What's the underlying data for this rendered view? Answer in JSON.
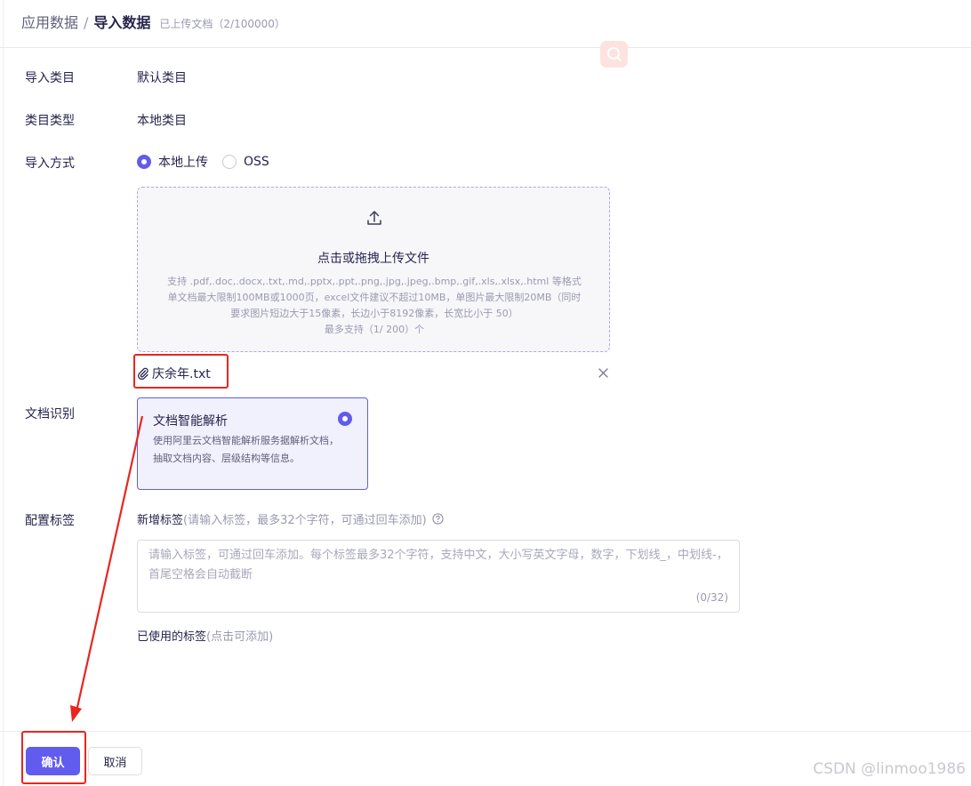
{
  "breadcrumb": {
    "parent": "应用数据",
    "separator": "/",
    "current": "导入数据",
    "meta": "已上传文档（2/100000）"
  },
  "form": {
    "category": {
      "label": "导入类目",
      "value": "默认类目"
    },
    "category_type": {
      "label": "类目类型",
      "value": "本地类目"
    },
    "import_method": {
      "label": "导入方式",
      "options": [
        {
          "label": "本地上传",
          "selected": true
        },
        {
          "label": "OSS",
          "selected": false
        }
      ]
    },
    "upload": {
      "icon": "upload-icon",
      "title": "点击或拖拽上传文件",
      "hint_lines": [
        "支持 .pdf,.doc,.docx,.txt,.md,.pptx,.ppt,.png,.jpg,.jpeg,.bmp,.gif,.xls,.xlsx,.html 等格式",
        "单文档最大限制100MB或1000页，excel文件建议不超过10MB，单图片最大限制20MB（同时",
        "要求图片短边大于15像素，长边小于8192像素，长宽比小于 50）",
        "最多支持（1/ 200）个"
      ]
    },
    "uploaded_file": {
      "name": "庆余年.txt",
      "icon": "paperclip-icon"
    },
    "doc_recognition": {
      "label": "文档识别",
      "option_title": "文档智能解析",
      "option_desc": "使用阿里云文档智能解析服务据解析文档，抽取文档内容、层级结构等信息。",
      "selected": true
    },
    "tags": {
      "label": "配置标签",
      "heading": "新增标签",
      "heading_hint": "(请输入标签，最多32个字符，可通过回车添加)",
      "placeholder": "请输入标签，可通过回车添加。每个标签最多32个字符，支持中文，大小写英文字母，数字，下划线_，中划线-，首尾空格会自动截断",
      "value": "",
      "counter": "(0/32)",
      "used_heading": "已使用的标签",
      "used_hint": "(点击可添加)"
    }
  },
  "footer": {
    "confirm_label": "确认",
    "cancel_label": "取消"
  },
  "watermark": "CSDN @linmoo1986",
  "colors": {
    "accent": "#615ced",
    "annotation": "#e8261f",
    "card_bg": "#f1f0fd"
  }
}
